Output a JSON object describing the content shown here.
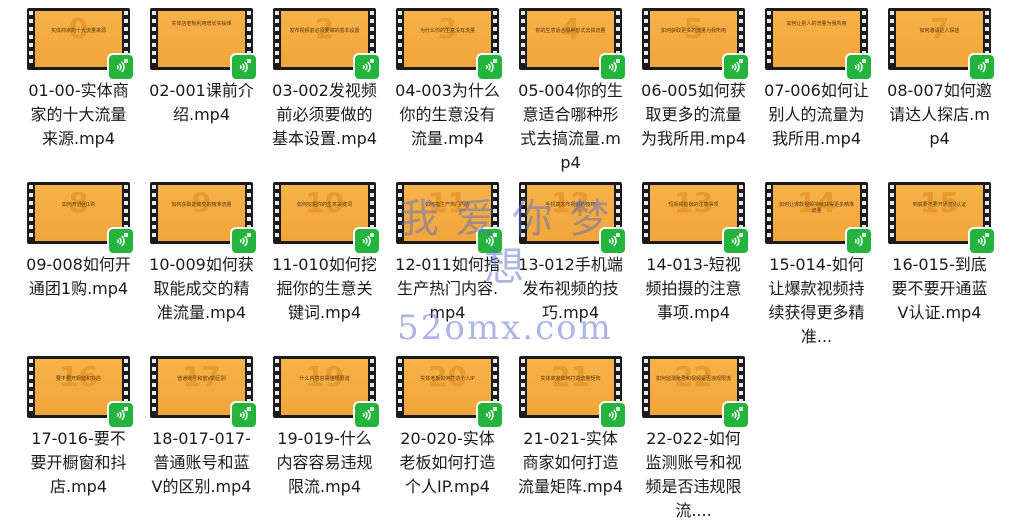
{
  "files": [
    {
      "number": "0",
      "thumb_text": "实体商家的十大流量来源",
      "label": "01-00-实体商家的十大流量来源.mp4"
    },
    {
      "number": "",
      "thumb_text": "实体店老板利用增长实操课",
      "label": "02-001课前介绍.mp4"
    },
    {
      "number": "2",
      "thumb_text": "发布视频前必须要做的基本设置",
      "label": "03-002发视频前必须要做的基本设置.mp4"
    },
    {
      "number": "3",
      "thumb_text": "为什么你的生意没有流量",
      "label": "04-003为什么你的生意没有流量.mp4"
    },
    {
      "number": "4",
      "thumb_text": "你的生意适合哪种形式去搞流量",
      "label": "05-004你的生意适合哪种形式去搞流量.mp4"
    },
    {
      "number": "5",
      "thumb_text": "如何获取更多的流量为我所用",
      "label": "06-005如何获取更多的流量为我所用.mp4"
    },
    {
      "number": "",
      "thumb_text": "如何让别人的流量为我所用",
      "label": "07-006如何让别人的流量为我所用.mp4"
    },
    {
      "number": "7",
      "thumb_text": "如何邀请达人探店",
      "label": "08-007如何邀请达人探店.mp4"
    },
    {
      "number": "8",
      "thumb_text": "如何开通团1购",
      "label": "09-008如何开通团1购.mp4"
    },
    {
      "number": "9",
      "thumb_text": "如何获取能成交的精准流量",
      "label": "10-009如何获取能成交的精准流量.mp4"
    },
    {
      "number": "10",
      "thumb_text": "如何挖掘你的生意关键词",
      "label": "11-010如何挖掘你的生意关键词.mp4"
    },
    {
      "number": "11",
      "thumb_text": "如何指生产热门内容",
      "label": "12-011如何指生产热门内容.mp4"
    },
    {
      "number": "12",
      "thumb_text": "手机端发布视频的技巧",
      "label": "13-012手机端发布视频的技巧.mp4"
    },
    {
      "number": "13",
      "thumb_text": "短视频拍摄的注意事项",
      "label": "14-013-短视频拍摄的注意事项.mp4"
    },
    {
      "number": "14",
      "thumb_text": "如何让爆款视频持续获得更多精准流量",
      "label": "15-014-如何让爆款视频持续获得更多精准..."
    },
    {
      "number": "15",
      "thumb_text": "到底要不要开通蓝V认证",
      "label": "16-015-到底要不要开通蓝V认证.mp4"
    },
    {
      "number": "16",
      "thumb_text": "要不要开橱窗和抖店",
      "label": "17-016-要不要开橱窗和抖店.mp4"
    },
    {
      "number": "17",
      "thumb_text": "普通账号和蓝V的区别",
      "label": "18-017-017-普通账号和蓝V的区别.mp4"
    },
    {
      "number": "19",
      "thumb_text": "什么内容容易违规限流",
      "label": "19-019-什么内容容易违规限流.mp4"
    },
    {
      "number": "20",
      "thumb_text": "实体老板如何打造个人IP",
      "label": "20-020-实体老板如何打造个人IP.mp4"
    },
    {
      "number": "21",
      "thumb_text": "实体商家如何打造流量矩阵",
      "label": "21-021-实体商家如何打造流量矩阵.mp4"
    },
    {
      "number": "22",
      "thumb_text": "如何监测账号和视频是否违规限流",
      "label": "22-022-如何监测账号和视频是否违规限流...."
    }
  ],
  "watermark": {
    "text": "我 爱 你 梦 想",
    "url": "52omx.com"
  },
  "colors": {
    "thumb_orange": "#f4ab42",
    "badge_green": "#24b43e",
    "film_strip": "#1b1b1b",
    "watermark": "#5a6ec8"
  },
  "icons": {
    "file_badge": "wechat-video-icon"
  }
}
